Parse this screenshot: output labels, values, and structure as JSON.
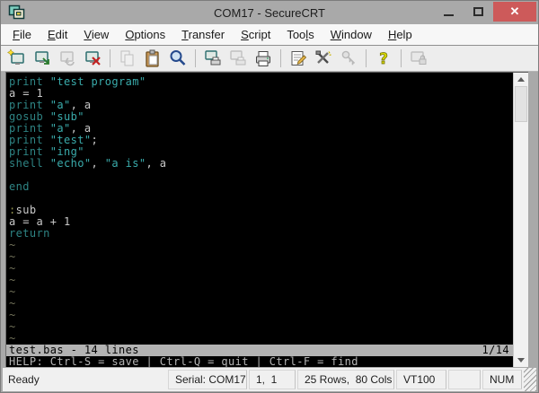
{
  "window": {
    "title": "COM17 - SecureCRT",
    "controls": {
      "minimize": "minimize",
      "maximize": "maximize",
      "close": "✕"
    }
  },
  "menu": {
    "items": [
      {
        "label": "File",
        "u": 0
      },
      {
        "label": "Edit",
        "u": 0
      },
      {
        "label": "View",
        "u": 0
      },
      {
        "label": "Options",
        "u": 0
      },
      {
        "label": "Transfer",
        "u": 0
      },
      {
        "label": "Script",
        "u": 0
      },
      {
        "label": "Tools",
        "u": 3
      },
      {
        "label": "Window",
        "u": 0
      },
      {
        "label": "Help",
        "u": 0
      }
    ]
  },
  "toolbar": {
    "icons": [
      "connect",
      "quick-connect",
      "reconnect",
      "disconnect",
      "copy",
      "paste",
      "find",
      "print-screen",
      "print-selection",
      "print",
      "session-options",
      "global-options",
      "key-exchange",
      "help",
      "lock-terminal"
    ],
    "disabled_icons": [
      "reconnect",
      "copy",
      "print-selection",
      "key-exchange",
      "lock-terminal"
    ]
  },
  "terminal": {
    "colors": {
      "kw": "#2e8484",
      "str": "#3aacac",
      "pl": "#c9c9c9",
      "tilde": "#73735a",
      "lbl": "#96964f"
    },
    "lines": [
      [
        [
          "kw",
          "print"
        ],
        [
          "pl",
          " "
        ],
        [
          "str",
          "\"test program\""
        ]
      ],
      [
        [
          "pl",
          "a = 1"
        ]
      ],
      [
        [
          "kw",
          "print"
        ],
        [
          "pl",
          " "
        ],
        [
          "str",
          "\"a\""
        ],
        [
          "pl",
          ", a"
        ]
      ],
      [
        [
          "kw",
          "gosub"
        ],
        [
          "pl",
          " "
        ],
        [
          "str",
          "\"sub\""
        ]
      ],
      [
        [
          "kw",
          "print"
        ],
        [
          "pl",
          " "
        ],
        [
          "str",
          "\"a\""
        ],
        [
          "pl",
          ", a"
        ]
      ],
      [
        [
          "kw",
          "print"
        ],
        [
          "pl",
          " "
        ],
        [
          "str",
          "\"test\""
        ],
        [
          "pl",
          ";"
        ]
      ],
      [
        [
          "kw",
          "print"
        ],
        [
          "pl",
          " "
        ],
        [
          "str",
          "\"ing\""
        ]
      ],
      [
        [
          "kw",
          "shell"
        ],
        [
          "pl",
          " "
        ],
        [
          "str",
          "\"echo\""
        ],
        [
          "pl",
          ", "
        ],
        [
          "str",
          "\"a is\""
        ],
        [
          "pl",
          ", a"
        ]
      ],
      [],
      [
        [
          "kw",
          "end"
        ]
      ],
      [],
      [
        [
          "lbl",
          ":"
        ],
        [
          "pl",
          "sub"
        ]
      ],
      [
        [
          "pl",
          "a = a + 1"
        ]
      ],
      [
        [
          "kw",
          "return"
        ]
      ],
      [
        [
          "tilde",
          "~"
        ]
      ],
      [
        [
          "tilde",
          "~"
        ]
      ],
      [
        [
          "tilde",
          "~"
        ]
      ],
      [
        [
          "tilde",
          "~"
        ]
      ],
      [
        [
          "tilde",
          "~"
        ]
      ],
      [
        [
          "tilde",
          "~"
        ]
      ],
      [
        [
          "tilde",
          "~"
        ]
      ],
      [
        [
          "tilde",
          "~"
        ]
      ],
      [
        [
          "tilde",
          "~"
        ]
      ]
    ],
    "file_status": {
      "left": "test.bas - 14 lines",
      "right": "1/14"
    },
    "help_line": "HELP: Ctrl-S = save | Ctrl-Q = quit | Ctrl-F = find"
  },
  "statusbar": {
    "ready": "Ready",
    "serial": "Serial: COM17",
    "cursor": "1,  1",
    "size": "25 Rows,  80 Cols",
    "emulation": "VT100",
    "extra": "",
    "num": "NUM"
  }
}
